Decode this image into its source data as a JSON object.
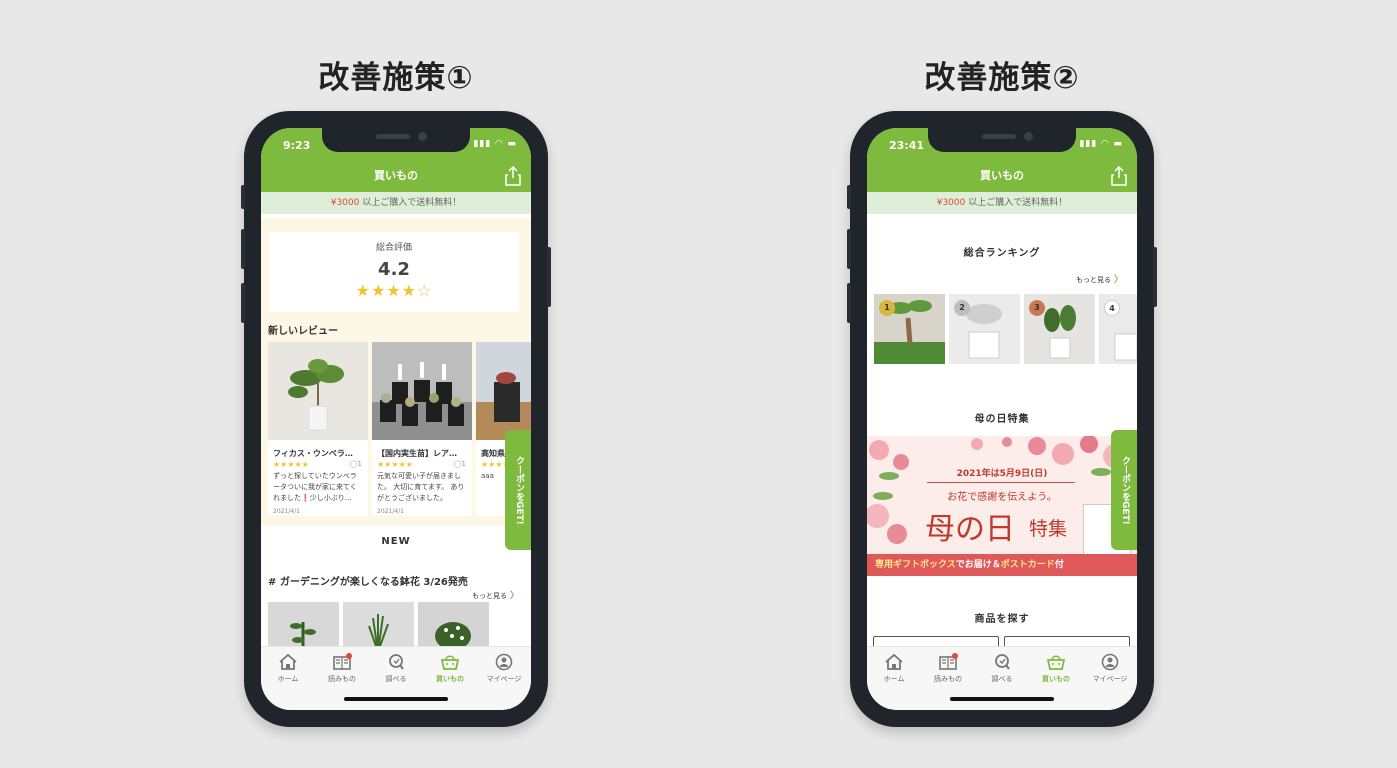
{
  "headings": {
    "left": "改善施策①",
    "right": "改善施策②"
  },
  "phone1": {
    "time": "9:23",
    "title": "買いもの",
    "promo_price": "¥3000",
    "promo_text": " 以上ご購入で送料無料！",
    "rating_label": "総合評価",
    "rating_score": "4.2",
    "rating_stars_value": 4.2,
    "reviews_title": "新しいレビュー",
    "reviews": [
      {
        "title": "フィカス・ウンベラ…",
        "comments": "1",
        "body": "ずっと探していたウンベラータついに我が家に来てくれました❗少し小ぶり…",
        "date": "2021/4/1"
      },
      {
        "title": "【国内実生苗】レア…",
        "comments": "1",
        "body": "元気な可愛い子が届きました。 大切に育てます。 ありがとうございました。",
        "date": "2021/4/1"
      },
      {
        "title": "高知県",
        "comments": "",
        "body": "aaa",
        "date": ""
      }
    ],
    "new_label": "NEW",
    "section_title": "# ガーデニングが楽しくなる鉢花 3/26発売",
    "more_label": "もっと見る",
    "coupon": "クーポンをGET!",
    "tabs": [
      "ホーム",
      "読みもの",
      "調べる",
      "買いもの",
      "マイページ"
    ]
  },
  "phone2": {
    "time": "23:41",
    "title": "買いもの",
    "promo_price": "¥3000",
    "promo_text": " 以上ご購入で送料無料！",
    "ranking_title": "総合ランキング",
    "more_label": "もっと見る",
    "ranks": [
      "1",
      "2",
      "3",
      "4"
    ],
    "feature_title": "母の日特集",
    "banner_date": "2021年は5月9日(日)",
    "banner_sub": "お花で感謝を伝えよう。",
    "banner_big": "母の日",
    "banner_big2": "特集",
    "banner_strip_a": "専用ギフトボックス",
    "banner_strip_b": "でお届け＆",
    "banner_strip_c": "ポストカード",
    "banner_strip_d": "付",
    "search_title": "商品を探す",
    "coupon": "クーポンをGET!",
    "tabs": [
      "ホーム",
      "読みもの",
      "調べる",
      "買いもの",
      "マイページ"
    ]
  },
  "colors": {
    "accent": "#7dba3d",
    "promo_bg": "#dfeed8",
    "price": "#e0463a",
    "star": "#f2c230",
    "badge": "#e0463a"
  }
}
